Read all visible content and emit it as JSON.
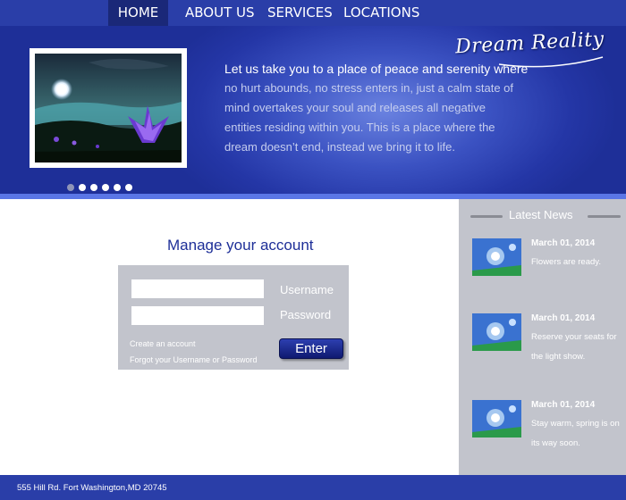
{
  "nav": {
    "items": [
      {
        "label": "HOME",
        "active": true
      },
      {
        "label": "ABOUT US"
      },
      {
        "label": "SERVICES"
      },
      {
        "label": "LOCATIONS"
      }
    ]
  },
  "hero": {
    "logo": "Dream Reality",
    "lead": "Let us take you to  a place of peace and serenity where",
    "body": "no hurt abounds, no stress enters in, just a calm state of mind overtakes your soul and releases all negative entities residing within you.  This is a place where the dream doesn’t end, instead we bring it to life.",
    "slides_total": 6,
    "slide_active_index": 0
  },
  "account": {
    "title": "Manage your account",
    "username_label": "Username",
    "password_label": "Password",
    "create_link": "Create an account",
    "forgot_link": "Forgot your Username or Password",
    "enter_button": "Enter"
  },
  "news": {
    "title": "Latest News",
    "items": [
      {
        "date": "March 01, 2014",
        "text": "Flowers are ready."
      },
      {
        "date": "March 01, 2014",
        "text": "Reserve your seats for the light show."
      },
      {
        "date": "March 01, 2014",
        "text": "Stay warm, spring is on its way soon."
      }
    ]
  },
  "footer": {
    "address": "555 Hill Rd. Fort Washington,MD 20745"
  },
  "colors": {
    "nav_bg": "#2a3ea8",
    "nav_active": "#1a2878",
    "hero_light": "#6a82e0",
    "panel_gray": "#c2c4cc",
    "title_blue": "#1e2f98"
  }
}
